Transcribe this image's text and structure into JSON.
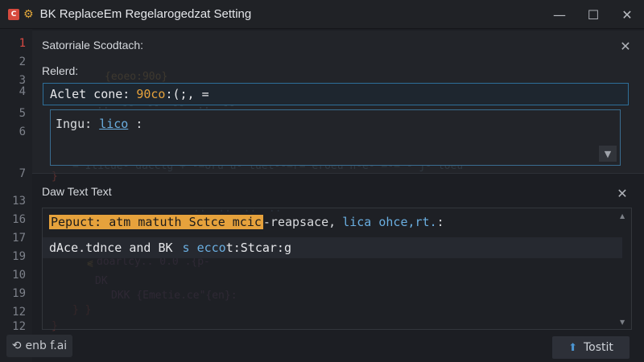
{
  "window": {
    "title": "BK ReplaceEm Regelarogedzat Setting",
    "app_icon": "app-icon",
    "settings_icon": "settings-icon",
    "controls": {
      "minimize": "—",
      "maximize": "☐",
      "close": "✕"
    }
  },
  "gutter": {
    "lines": [
      "1",
      "2",
      "3",
      "4",
      "5",
      "6",
      "7",
      "13",
      "16",
      "17",
      "19",
      "10",
      "19",
      "12",
      "12"
    ],
    "active_index": 0
  },
  "top_panel": {
    "title": "Satorriale Scodtach:",
    "close_symbol": "✕",
    "section_label": "Relerd:",
    "adjust": {
      "label": "Aclet cone:",
      "value": "90co",
      "suffix": ":(;, ="
    },
    "input": {
      "label": "Ingu:",
      "value": "lico",
      "suffix": ":",
      "dropdown_symbol": "▼"
    }
  },
  "bottom_panel": {
    "title": "Daw Text Text",
    "close_symbol": "✕",
    "result_row1": {
      "highlight": "Pepuct: atm matuth Sctce mcic",
      "rest": "-reapsace,",
      "link": "lica ohce,rt.",
      "end": ":"
    },
    "result_row2": {
      "text": "dAce.tdnce and BK",
      "chip": "s ecco",
      "end": "t:Stcar:g"
    },
    "scroll": {
      "up": "▲",
      "down": "▼"
    }
  },
  "footer": {
    "left_button": {
      "icon": "replace-icon",
      "label": "enb f.ai"
    },
    "right_button": {
      "icon": "upload-icon",
      "label": "Tostit"
    }
  },
  "colors": {
    "accent_orange": "#e6a23c",
    "link_blue": "#6aaee0",
    "active_line_red": "#d84a43",
    "border_blue": "#2e6f99"
  }
}
